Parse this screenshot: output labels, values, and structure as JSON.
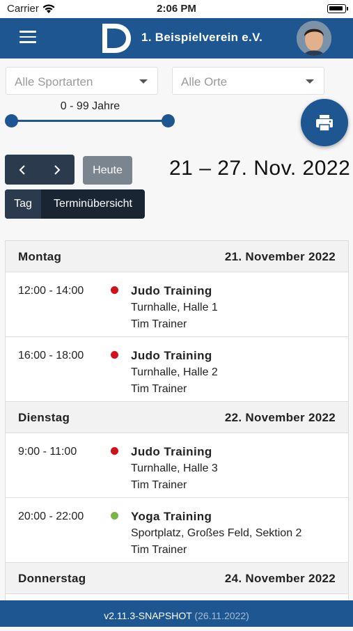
{
  "status_bar": {
    "carrier": "Carrier",
    "time": "2:06 PM"
  },
  "header": {
    "club_name": "1. Beispielverein e.V."
  },
  "filters": {
    "sport": "Alle Sportarten",
    "place": "Alle Orte",
    "age_range": "0 - 99 Jahre",
    "age_min": 0,
    "age_max": 99
  },
  "navigation": {
    "today_label": "Heute",
    "date_range": "21 – 27. Nov. 2022",
    "view_day": "Tag",
    "view_overview": "Terminübersicht"
  },
  "colors": {
    "primary": "#1d5691",
    "judo": "#d0121b",
    "yoga": "#7ab648"
  },
  "schedule": {
    "days": [
      {
        "name": "Montag",
        "date": "21. November 2022",
        "events": [
          {
            "time": "12:00 - 14:00",
            "title": "Judo Training",
            "place": "Turnhalle, Halle 1",
            "trainer": "Tim Trainer",
            "color": "#d0121b"
          },
          {
            "time": "16:00 - 18:00",
            "title": "Judo Training",
            "place": "Turnhalle, Halle 2",
            "trainer": "Tim Trainer",
            "color": "#d0121b"
          }
        ]
      },
      {
        "name": "Dienstag",
        "date": "22. November 2022",
        "events": [
          {
            "time": "9:00 - 11:00",
            "title": "Judo Training",
            "place": "Turnhalle, Halle 3",
            "trainer": "Tim Trainer",
            "color": "#d0121b"
          },
          {
            "time": "20:00 - 22:00",
            "title": "Yoga Training",
            "place": "Sportplatz, Großes Feld, Sektion 2",
            "trainer": "Tim Trainer",
            "color": "#7ab648"
          }
        ]
      },
      {
        "name": "Donnerstag",
        "date": "24. November 2022",
        "events": []
      }
    ]
  },
  "footer": {
    "version": "v2.11.3-SNAPSHOT",
    "build_date": "(26.11.2022)"
  }
}
